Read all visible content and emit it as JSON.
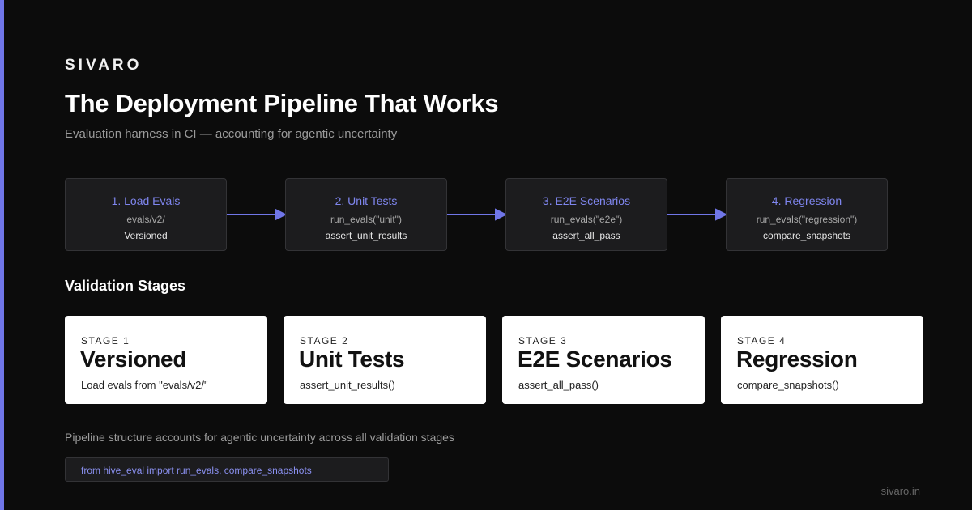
{
  "brand": "SIVARO",
  "title": "The Deployment Pipeline That Works",
  "subtitle": "Evaluation harness in CI — accounting for agentic uncertainty",
  "flow": [
    {
      "title": "1. Load Evals",
      "line1": "evals/v2/",
      "line2": "Versioned"
    },
    {
      "title": "2. Unit Tests",
      "line1": "run_evals(\"unit\")",
      "line2": "assert_unit_results"
    },
    {
      "title": "3. E2E Scenarios",
      "line1": "run_evals(\"e2e\")",
      "line2": "assert_all_pass"
    },
    {
      "title": "4. Regression",
      "line1": "run_evals(\"regression\")",
      "line2": "compare_snapshots"
    }
  ],
  "section_heading": "Validation Stages",
  "stages": [
    {
      "label": "STAGE 1",
      "name": "Versioned",
      "desc": "Load evals from \"evals/v2/\""
    },
    {
      "label": "STAGE 2",
      "name": "Unit Tests",
      "desc": "assert_unit_results()"
    },
    {
      "label": "STAGE 3",
      "name": "E2E Scenarios",
      "desc": "assert_all_pass()"
    },
    {
      "label": "STAGE 4",
      "name": "Regression",
      "desc": "compare_snapshots()"
    }
  ],
  "footnote": "Pipeline structure accounts for agentic uncertainty across all validation stages",
  "code": "from hive_eval import run_evals, compare_snapshots",
  "site": "sivaro.in",
  "colors": {
    "accent": "#7076e8",
    "background": "#0c0c0c",
    "box": "#1c1c1e",
    "card": "#ffffff"
  }
}
